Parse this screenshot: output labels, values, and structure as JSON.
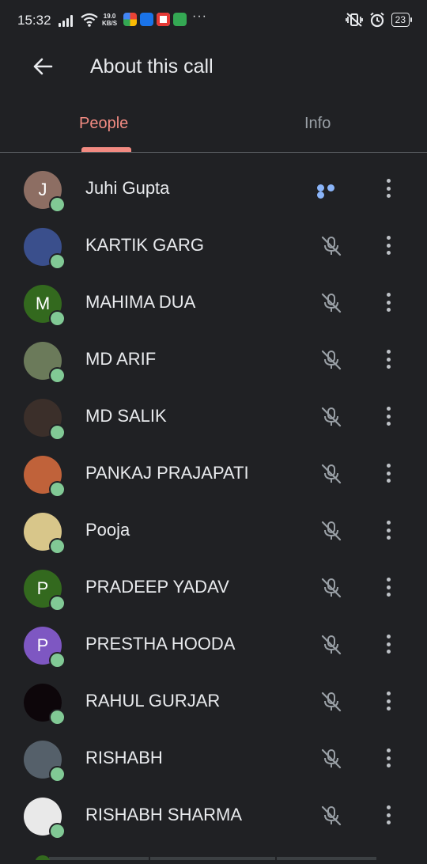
{
  "status_bar": {
    "time": "15:32",
    "speed_value": "19.0",
    "speed_unit": "KB/S",
    "battery": "23"
  },
  "header": {
    "title": "About this call",
    "back_icon": "arrow-back-icon"
  },
  "tabs": [
    {
      "label": "People",
      "selected": true
    },
    {
      "label": "Info",
      "selected": false
    }
  ],
  "colors": {
    "background": "#202124",
    "accent": "#f28b82",
    "presence": "#81c995",
    "speaking": "#8ab4f8"
  },
  "participants": [
    {
      "name": "Juhi Gupta",
      "initial": "J",
      "avatar_color": "#8d6e63",
      "status": "speaking"
    },
    {
      "name": "KARTIK GARG",
      "initial": "",
      "avatar_color": "#3a4f8c",
      "status": "muted"
    },
    {
      "name": "MAHIMA DUA",
      "initial": "M",
      "avatar_color": "#33691e",
      "status": "muted"
    },
    {
      "name": "MD ARIF",
      "initial": "",
      "avatar_color": "#6b7a5a",
      "status": "muted"
    },
    {
      "name": "MD SALIK",
      "initial": "",
      "avatar_color": "#3b2f2a",
      "status": "muted"
    },
    {
      "name": "PANKAJ PRAJAPATI",
      "initial": "",
      "avatar_color": "#c0623a",
      "status": "muted"
    },
    {
      "name": "Pooja",
      "initial": "",
      "avatar_color": "#d8c68a",
      "status": "muted"
    },
    {
      "name": "PRADEEP YADAV",
      "initial": "P",
      "avatar_color": "#33691e",
      "status": "muted"
    },
    {
      "name": "PRESTHA HOODA",
      "initial": "P",
      "avatar_color": "#7e57c2",
      "status": "muted"
    },
    {
      "name": "RAHUL GURJAR",
      "initial": "",
      "avatar_color": "#0d060a",
      "status": "muted"
    },
    {
      "name": "RISHABH",
      "initial": "",
      "avatar_color": "#55606a",
      "status": "muted"
    },
    {
      "name": "RISHABH SHARMA",
      "initial": "",
      "avatar_color": "#e9e9e9",
      "status": "muted"
    }
  ]
}
